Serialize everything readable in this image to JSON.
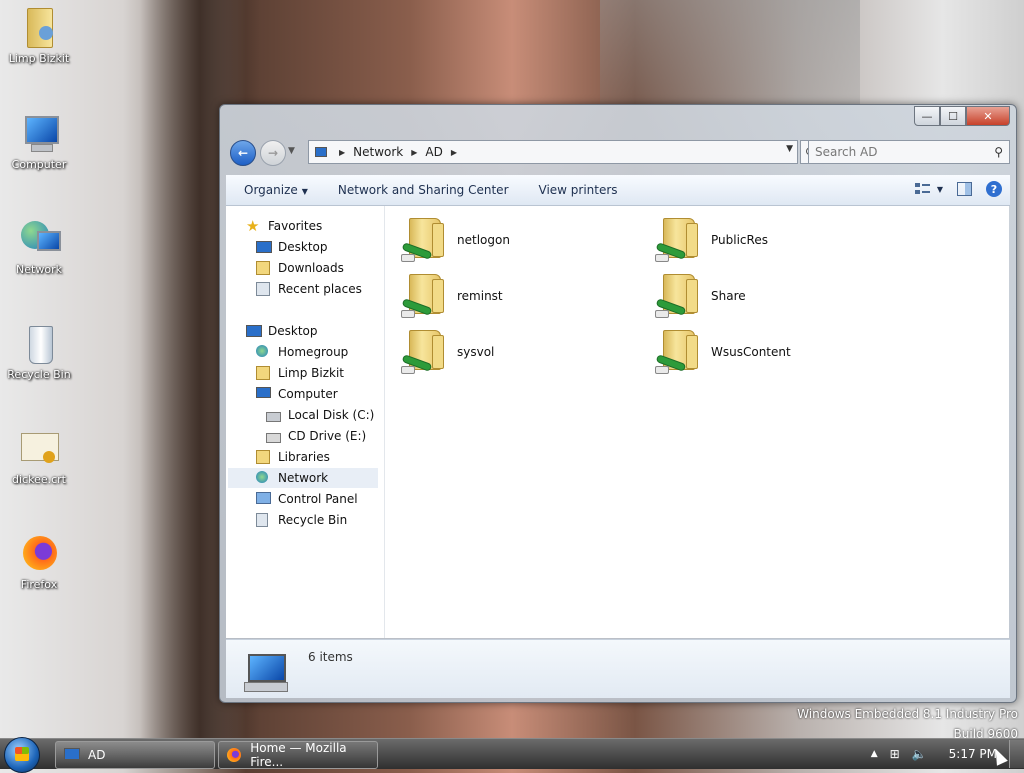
{
  "desktop": {
    "icons": [
      {
        "label": "Limp Bizkit",
        "icon": "user-folder-icon"
      },
      {
        "label": "Computer",
        "icon": "computer-icon"
      },
      {
        "label": "Network",
        "icon": "network-icon"
      },
      {
        "label": "Recycle Bin",
        "icon": "recycle-bin-icon"
      },
      {
        "label": "dickee.crt",
        "icon": "certificate-icon"
      },
      {
        "label": "Firefox",
        "icon": "firefox-icon"
      }
    ],
    "watermark_line1": "Windows Embedded 8.1 Industry Pro",
    "watermark_line2": "Build 9600"
  },
  "window": {
    "controls": {
      "minimize": "—",
      "maximize": "☐",
      "close": "✕"
    },
    "address": {
      "crumbs": [
        "Network",
        "AD"
      ]
    },
    "search": {
      "placeholder": "Search AD"
    },
    "toolbar": {
      "organize": "Organize",
      "network_sharing": "Network and Sharing Center",
      "view_printers": "View printers"
    },
    "nav_pane": {
      "favorites": "Favorites",
      "fav_items": [
        "Desktop",
        "Downloads",
        "Recent places"
      ],
      "desktop": "Desktop",
      "desktop_items": [
        "Homegroup",
        "Limp Bizkit",
        "Computer"
      ],
      "computer_items": [
        "Local Disk (C:)",
        "CD Drive (E:)"
      ],
      "more_items": [
        "Libraries",
        "Network",
        "Control Panel",
        "Recycle Bin"
      ],
      "selected": "Network"
    },
    "files": [
      "netlogon",
      "PublicRes",
      "reminst",
      "Share",
      "sysvol",
      "WsusContent"
    ],
    "status": {
      "count": "6 items"
    }
  },
  "taskbar": {
    "tasks": [
      {
        "label": "AD",
        "icon": "network-icon"
      },
      {
        "label": "Home — Mozilla Fire...",
        "icon": "firefox-icon"
      }
    ],
    "clock": "5:17 PM"
  },
  "colors": {
    "accent": "#2f6fd0",
    "folder": "#f7e59c",
    "share_pipe": "#2d9b3a"
  }
}
